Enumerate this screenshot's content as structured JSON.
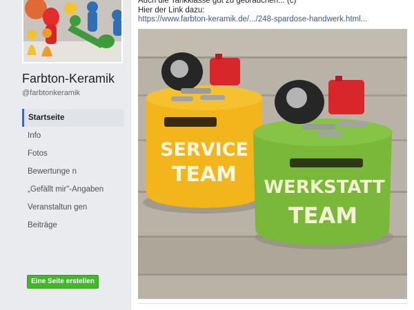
{
  "page": {
    "name": "Farbton-Keramik",
    "handle": "@farbtonkeramik"
  },
  "nav": [
    {
      "label": "Startseite",
      "active": true
    },
    {
      "label": "Info"
    },
    {
      "label": "Fotos"
    },
    {
      "label": "Bewertunge n"
    },
    {
      "label": "„Gefällt mir\"-Angaben"
    },
    {
      "label": "Veranstaltun gen"
    },
    {
      "label": "Beiträge"
    }
  ],
  "create_page_button": "Eine Seite erstellen",
  "post": {
    "text_line1": "Auch die Tankklasse gut zu gebrauchen... (c)",
    "text_line2": "Hier der Link dazu:",
    "link": "https://www.farbton-keramik.de/.../248-spardose-handwerk.html..."
  },
  "photo": {
    "jar_left_text_1": "SERVICE",
    "jar_left_text_2": "TEAM",
    "jar_right_text_1": "WERKSTATT",
    "jar_right_text_2": "TEAM",
    "colors": {
      "jar_left": "#f2b51c",
      "jar_right": "#7ab83a",
      "wood": "#b8b0a3",
      "canister": "#d8262b"
    }
  }
}
